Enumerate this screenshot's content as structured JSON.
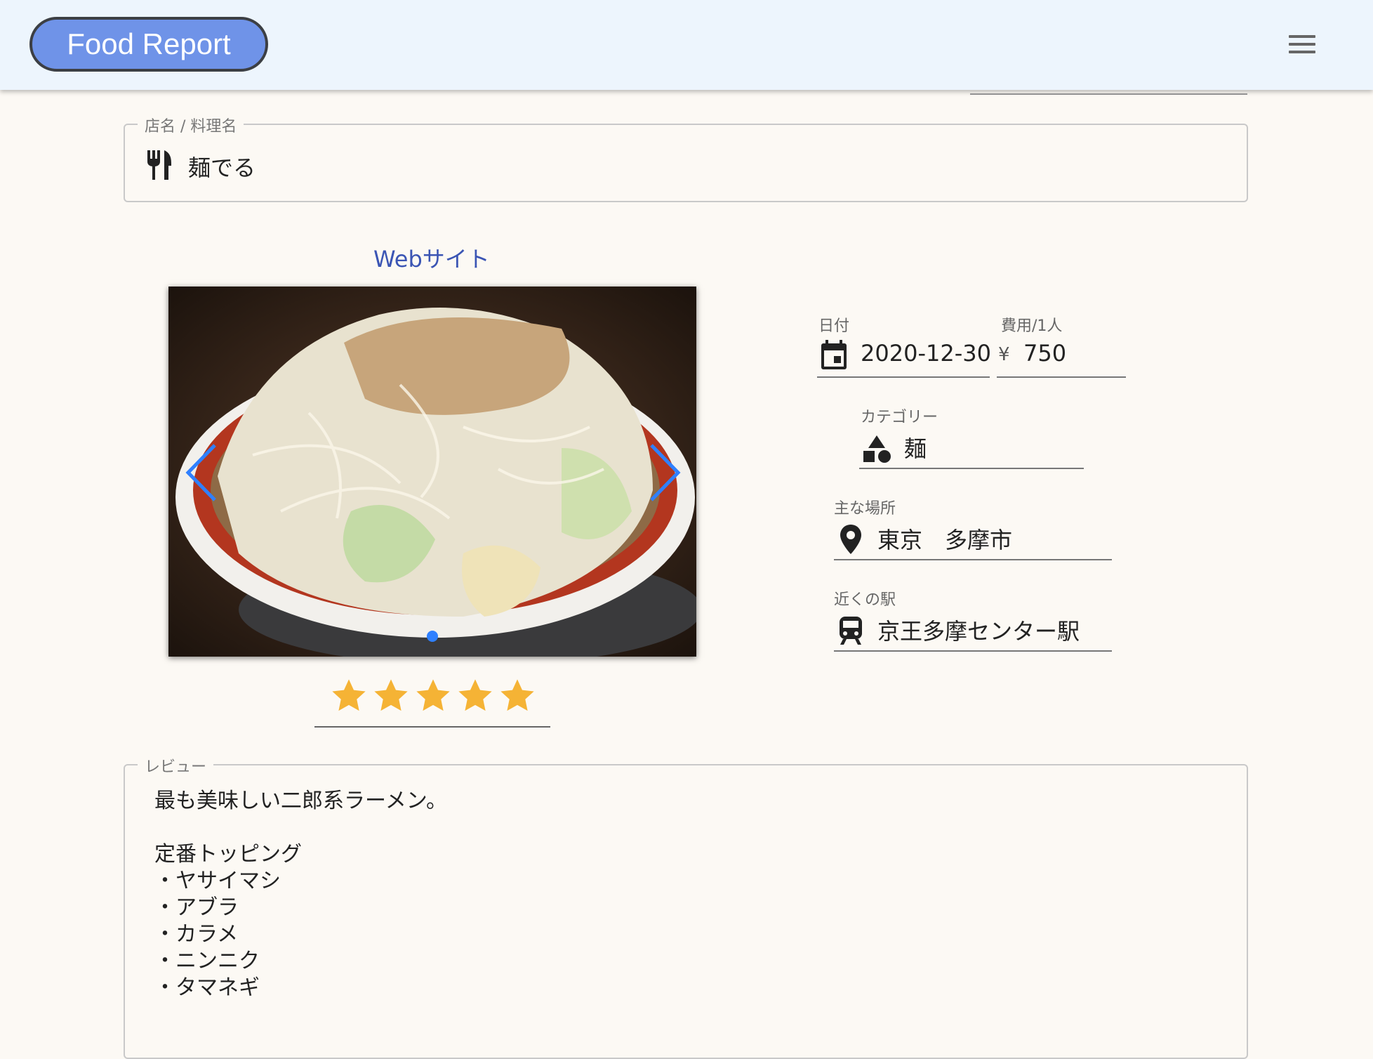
{
  "header": {
    "brand": "Food Report",
    "menu_icon": "hamburger-menu-icon"
  },
  "name_field": {
    "legend": "店名 / 料理名",
    "icon": "restaurant-icon",
    "value": "麺でる"
  },
  "website_link": "Webサイト",
  "carousel": {
    "prev_icon": "chevron-left-icon",
    "next_icon": "chevron-right-icon",
    "slide_count": 1,
    "active_slide": 1
  },
  "rating": {
    "value": 5,
    "max": 5,
    "star_color": "#f5b335"
  },
  "details": {
    "date": {
      "label": "日付",
      "icon": "calendar-icon",
      "value": "2020-12-30"
    },
    "cost": {
      "label": "費用/1人",
      "symbol": "¥",
      "value": "750"
    },
    "category": {
      "label": "カテゴリー",
      "icon": "category-shapes-icon",
      "value": "麺"
    },
    "location": {
      "label": "主な場所",
      "icon": "map-pin-icon",
      "value": "東京　多摩市"
    },
    "station": {
      "label": "近くの駅",
      "icon": "train-icon",
      "value": "京王多摩センター駅"
    }
  },
  "review": {
    "legend": "レビュー",
    "lines": [
      "最も美味しい二郎系ラーメン。",
      "",
      "定番トッピング",
      "・ヤサイマシ",
      "・アブラ",
      "・カラメ",
      "・ニンニク",
      "・タマネギ"
    ]
  },
  "colors": {
    "header_bg": "#edf5fd",
    "brand_bg": "#6f93e8",
    "page_bg": "#fcf9f4",
    "link": "#3b55b4",
    "carousel_accent": "#2f80ff"
  }
}
